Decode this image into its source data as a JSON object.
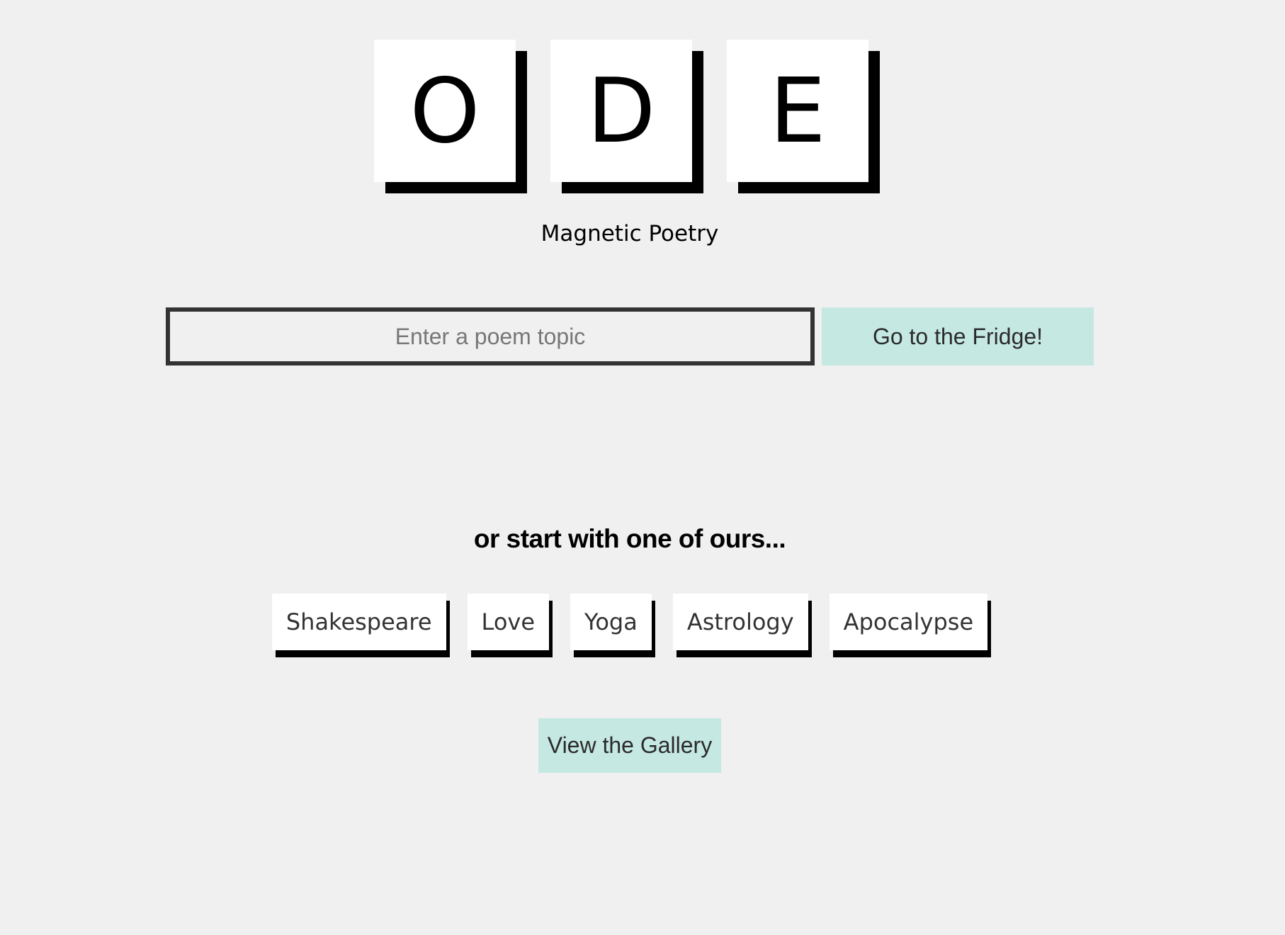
{
  "logo": {
    "letters": [
      "O",
      "D",
      "E"
    ]
  },
  "subtitle": "Magnetic Poetry",
  "topic_form": {
    "input_value": "",
    "input_placeholder": "Enter a poem topic",
    "submit_label": "Go to the Fridge!"
  },
  "presets": {
    "heading": "or start with one of ours...",
    "items": [
      "Shakespeare",
      "Love",
      "Yoga",
      "Astrology",
      "Apocalypse"
    ]
  },
  "gallery_label": "View the Gallery",
  "colors": {
    "background": "#f0f0f0",
    "accent": "#c5e8e2",
    "tile": "#ffffff",
    "shadow": "#000000"
  }
}
